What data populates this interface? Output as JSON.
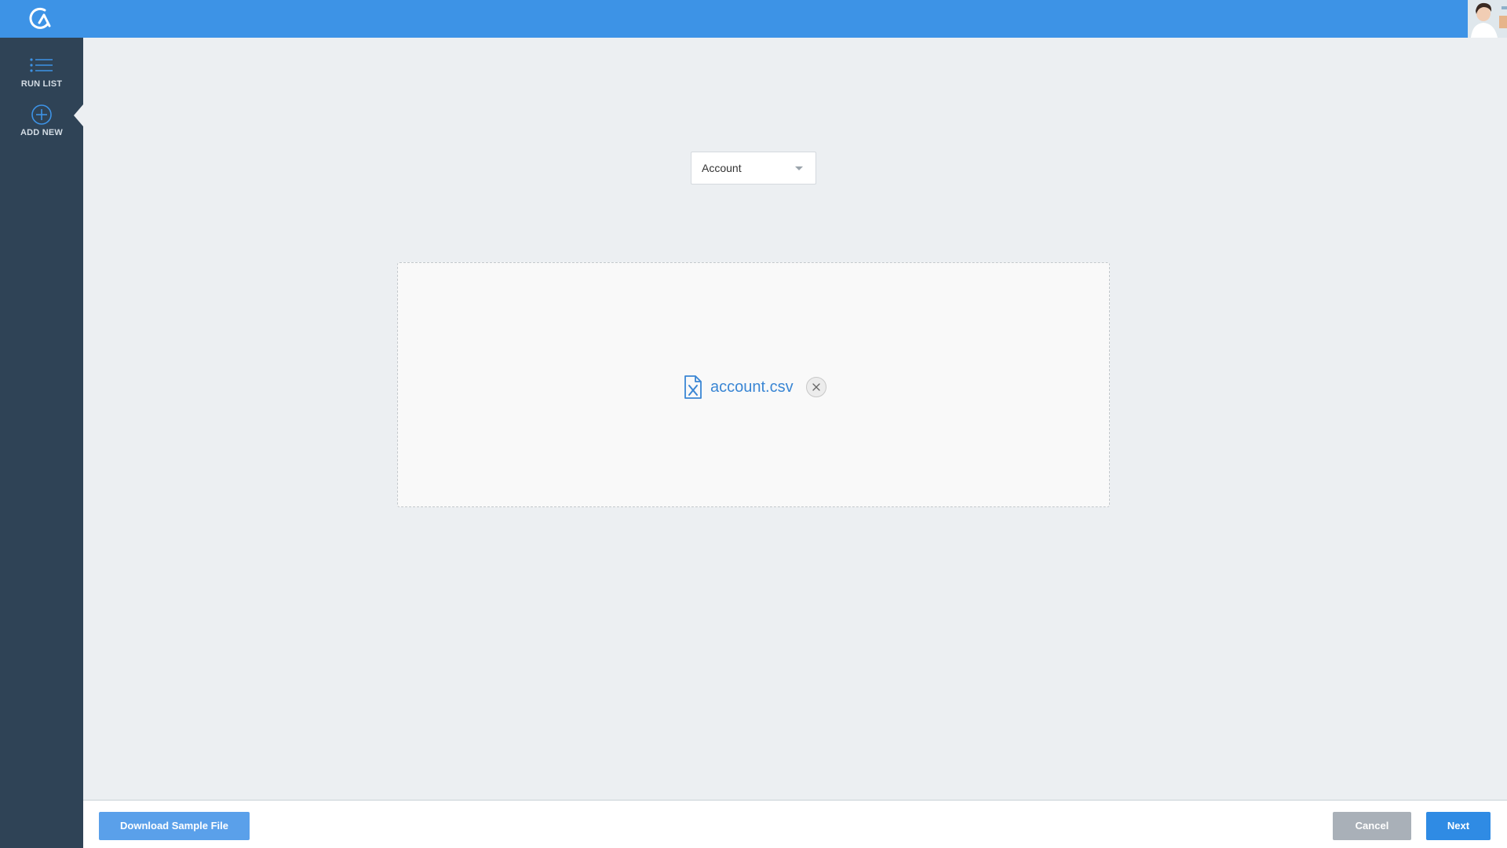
{
  "header": {
    "logo_icon": "app-logo-icon",
    "accent_color": "#3d93e6",
    "avatar": "user-avatar"
  },
  "sidebar": {
    "items": [
      {
        "label": "RUN LIST",
        "icon": "list-icon"
      },
      {
        "label": "ADD NEW",
        "icon": "plus-circle-icon",
        "active": true
      }
    ]
  },
  "main": {
    "object_select": {
      "value": "Account"
    },
    "dropzone": {
      "file_name": "account.csv",
      "file_icon": "excel-file-icon",
      "remove_icon": "close-icon"
    }
  },
  "footer": {
    "download_label": "Download Sample File",
    "cancel_label": "Cancel",
    "next_label": "Next"
  }
}
